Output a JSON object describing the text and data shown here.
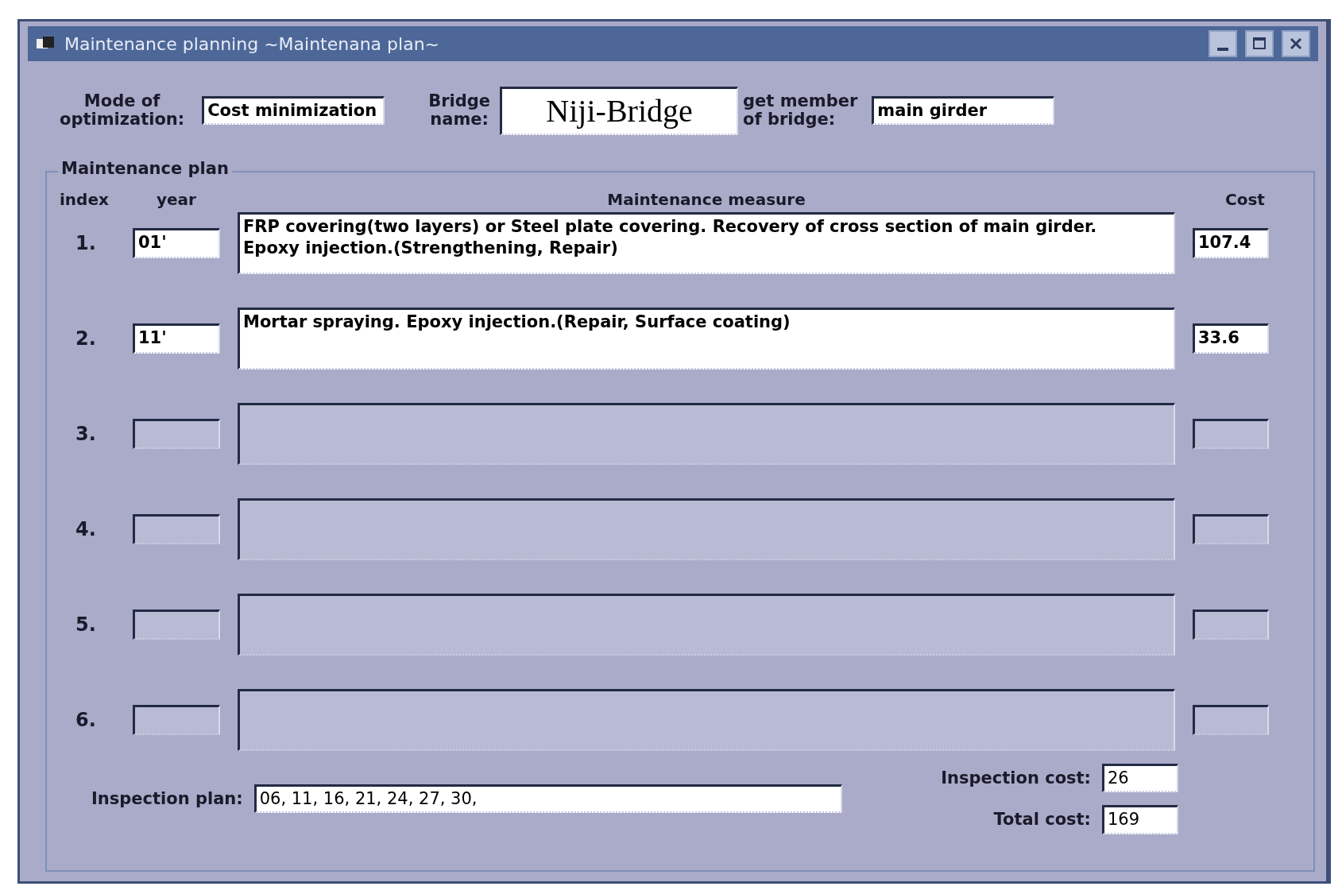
{
  "window": {
    "title": "Maintenance planning ~Maintenana plan~"
  },
  "header": {
    "mode_label": "Mode of\noptimization:",
    "mode_value": "Cost minimization",
    "bridge_label": "Bridge\nname:",
    "bridge_value": "Niji-Bridge",
    "member_label": "get member\nof bridge:",
    "member_value": "main girder"
  },
  "plan": {
    "group_title": "Maintenance plan",
    "columns": [
      "index",
      "year",
      "Maintenance measure",
      "Cost"
    ],
    "rows": [
      {
        "index": "1.",
        "year": "01'",
        "measure": "FRP covering(two layers) or Steel plate covering. Recovery of cross section of main girder.\nEpoxy injection.(Strengthening, Repair)",
        "cost": "107.4",
        "disabled": false
      },
      {
        "index": "2.",
        "year": "11'",
        "measure": "Mortar spraying. Epoxy injection.(Repair, Surface coating)",
        "cost": "33.6",
        "disabled": false
      },
      {
        "index": "3.",
        "disabled": true
      },
      {
        "index": "4.",
        "disabled": true
      },
      {
        "index": "5.",
        "disabled": true
      },
      {
        "index": "6.",
        "disabled": true
      }
    ]
  },
  "footer": {
    "inspection_plan_label": "Inspection plan:",
    "inspection_plan_value": "06, 11, 16, 21, 24, 27, 30,",
    "inspection_cost_label": "Inspection cost:",
    "inspection_cost_value": "26",
    "total_cost_label": "Total cost:",
    "total_cost_value": "169"
  }
}
